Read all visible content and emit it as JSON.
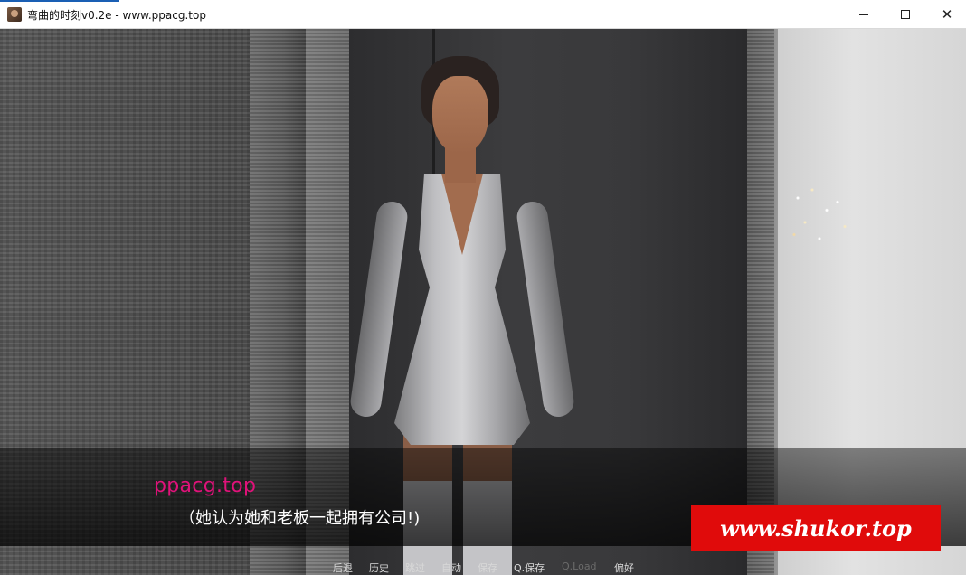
{
  "window": {
    "title": "弯曲的时刻v0.2e - www.ppacg.top",
    "icon": "game-portrait-icon",
    "minimize_icon": "minimize-icon",
    "maximize_icon": "maximize-icon",
    "close_glyph": "✕"
  },
  "dialogue": {
    "speaker": "ppacg.top",
    "text": "（她认为她和老板一起拥有公司!)",
    "speaker_color": "#e0127a"
  },
  "watermark": {
    "text": "www.shukor.top",
    "background": "#e00b0b"
  },
  "quick_menu": {
    "back": "后退",
    "history": "历史",
    "skip": "跳过",
    "auto": "自动",
    "save": "保存",
    "quick_save": "Q.保存",
    "quick_load": "Q.Load",
    "preferences": "偏好"
  }
}
